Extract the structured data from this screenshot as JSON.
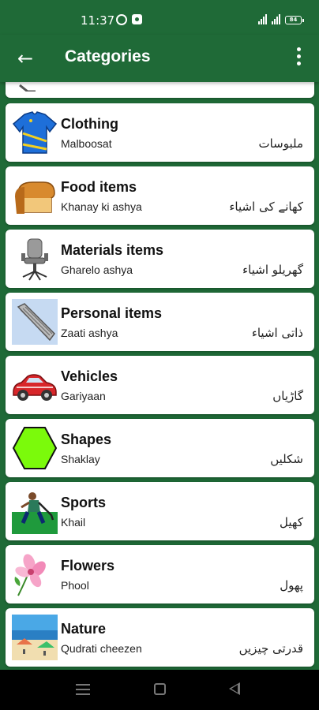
{
  "status_bar": {
    "time": "11:37",
    "battery": "84"
  },
  "app_bar": {
    "title": "Categories",
    "back_icon": "arrow-left-icon",
    "menu_icon": "more-vertical-icon"
  },
  "categories": [
    {
      "title": "",
      "subtitle": "",
      "urdu": "",
      "icon": "partial-icon"
    },
    {
      "title": "Clothing",
      "subtitle": "Malboosat",
      "urdu": "ملبوسات",
      "icon": "shirt-icon"
    },
    {
      "title": "Food items",
      "subtitle": "Khanay ki ashya",
      "urdu": "کھانے کی اشیاء",
      "icon": "bread-icon"
    },
    {
      "title": "Materials items",
      "subtitle": "Gharelo ashya",
      "urdu": "گھریلو اشیاء",
      "icon": "chair-icon"
    },
    {
      "title": "Personal items",
      "subtitle": "Zaati ashya",
      "urdu": "ذاتی اشیاء",
      "icon": "comb-icon"
    },
    {
      "title": "Vehicles",
      "subtitle": "Gariyaan",
      "urdu": "گاڑیاں",
      "icon": "car-icon"
    },
    {
      "title": "Shapes",
      "subtitle": "Shaklay",
      "urdu": "شکلیں",
      "icon": "hexagon-icon"
    },
    {
      "title": "Sports",
      "subtitle": "Khail",
      "urdu": "کھیل",
      "icon": "hockey-player-icon"
    },
    {
      "title": "Flowers",
      "subtitle": "Phool",
      "urdu": "پھول",
      "icon": "flower-icon"
    },
    {
      "title": "Nature",
      "subtitle": "Qudrati cheezen",
      "urdu": "قدرتی چیزیں",
      "icon": "beach-icon"
    }
  ],
  "nav_bar": {
    "menu_icon": "recent-apps-icon",
    "home_icon": "home-icon",
    "back_icon": "back-triangle-icon"
  }
}
